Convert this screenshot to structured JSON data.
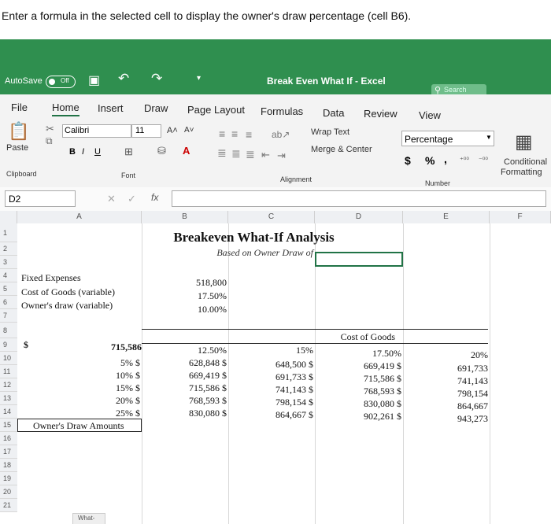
{
  "instruction": "Enter a formula in the selected cell to display the owner's draw percentage (cell B6).",
  "titlebar": {
    "autosave": "AutoSave",
    "autosave_state": "Off",
    "title": "Break Even What If - Excel",
    "search": "Search"
  },
  "tabs": [
    "File",
    "Home",
    "Insert",
    "Draw",
    "Page Layout",
    "Formulas",
    "Data",
    "Review",
    "View"
  ],
  "ribbon": {
    "paste": "Paste",
    "font_name": "Calibri",
    "font_size": "11",
    "bold": "B",
    "italic": "I",
    "underline": "U",
    "wrap_text": "Wrap Text",
    "merge_center": "Merge & Center",
    "number_format": "Percentage",
    "currency": "$",
    "percent": "%",
    "comma": ",",
    "conditional": "Conditional",
    "formatting": "Formatting",
    "groups": {
      "clipboard": "Clipboard",
      "font": "Font",
      "alignment": "Alignment",
      "number": "Number"
    }
  },
  "formula_bar": {
    "name_box": "D2",
    "fx": "fx",
    "content": ""
  },
  "columns": [
    "A",
    "B",
    "C",
    "D",
    "E",
    "F"
  ],
  "rows": [
    "1",
    "2",
    "3",
    "4",
    "5",
    "6",
    "7",
    "8",
    "9",
    "10",
    "11",
    "12",
    "13",
    "14",
    "15",
    "16",
    "17",
    "18",
    "19",
    "20",
    "21"
  ],
  "sheet": {
    "title": "Breakeven What-If Analysis",
    "subtitle": "Based on Owner Draw of",
    "fixed_expenses_label": "Fixed Expenses",
    "fixed_expenses_value": "518,800",
    "cogs_label": "Cost of Goods (variable)",
    "cogs_value": "17.50%",
    "owners_draw_label": "Owner's draw (variable)",
    "owners_draw_value": "10.00%",
    "table_header": "Cost of Goods",
    "corner_dollar": "$",
    "corner_value": "715,586",
    "col_pcts": [
      "12.50%",
      "15%",
      "17.50%",
      "20%"
    ],
    "row_pcts": [
      "5% $",
      "10% $",
      "15% $",
      "20% $",
      "25% $"
    ],
    "values": [
      [
        "628,848 $",
        "648,500 $",
        "669,419 $",
        "691,733"
      ],
      [
        "669,419 $",
        "691,733 $",
        "715,586 $",
        "741,143"
      ],
      [
        "715,586 $",
        "741,143 $",
        "768,593 $",
        "798,154"
      ],
      [
        "768,593 $",
        "798,154 $",
        "830,080 $",
        "864,667"
      ],
      [
        "830,080 $",
        "864,667 $",
        "902,261 $",
        "943,273"
      ]
    ],
    "owners_draw_amounts": "Owner's Draw Amounts",
    "sheet_tab": "What-"
  }
}
